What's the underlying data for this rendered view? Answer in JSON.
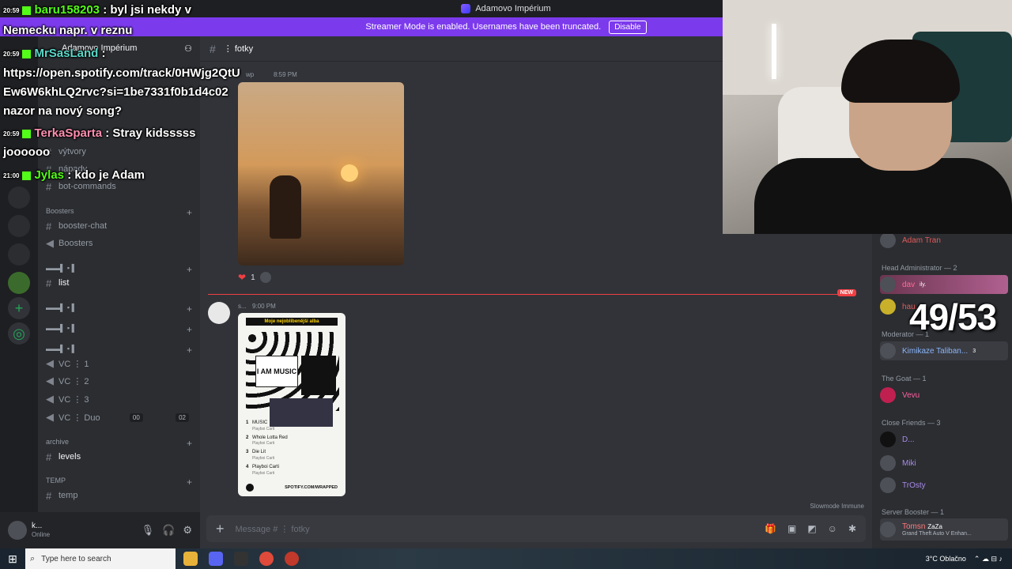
{
  "window": {
    "title": "Adamovo Impérium"
  },
  "streamer": {
    "text": "Streamer Mode is enabled. Usernames have been truncated.",
    "disable_label": "Disable"
  },
  "server": {
    "name": "Adamovo Impérium"
  },
  "sidebar": {
    "channels_top": [
      {
        "label": "výtvory"
      },
      {
        "label": "nápady"
      },
      {
        "label": "bot-commands"
      }
    ],
    "cat_boosters": "Boosters",
    "boosters": [
      {
        "label": "booster-chat"
      },
      {
        "label": "Boosters"
      }
    ],
    "list": "list",
    "vcs": [
      {
        "label": "VC ⋮ 1"
      },
      {
        "label": "VC ⋮ 2"
      },
      {
        "label": "VC ⋮ 3"
      },
      {
        "label": "VC ⋮ Duo"
      }
    ],
    "duo_a": "00",
    "duo_b": "02",
    "cat_archive": "archive",
    "levels": "levels",
    "cat_temp": "TEMP",
    "temp": "temp"
  },
  "user": {
    "name": "k...",
    "status": "Online"
  },
  "channel": {
    "name": "⋮ fotky"
  },
  "messages": {
    "m1_user": "wp",
    "m1_time": "8:59 PM",
    "reaction_count": "1",
    "new_label": "NEW",
    "m2_user": "s...",
    "m2_time": "9:00 PM",
    "card_title": "Moje nejoblíbenější alba",
    "card_music": "I AM MUSIC",
    "tracks": [
      {
        "n": "1",
        "title": "MUSIC",
        "artist": "Playboi Carti"
      },
      {
        "n": "2",
        "title": "Whole Lotta Red",
        "artist": "Playboi Carti"
      },
      {
        "n": "3",
        "title": "Die Lit",
        "artist": "Playboi Carti"
      },
      {
        "n": "4",
        "title": "Playboi Carti",
        "artist": "Playboi Carti"
      }
    ],
    "card_foot": "SPOTIFY.COM/WRAPPED"
  },
  "slowmode": "Slowmode Immune",
  "composer": {
    "placeholder": "Message # ⋮ fotky"
  },
  "members": {
    "top": "Adam Tran",
    "head_admin": "Head Administrator — 2",
    "dav": "dav",
    "dav_badge": "ily.",
    "hau": "hau...",
    "moderator": "Moderator — 1",
    "kimi": "Kimikaze Taliban...",
    "kimi_count": "3",
    "goat": "The Goat — 1",
    "vevu": "Vevu",
    "close": "Close Friends — 3",
    "d": "D...",
    "miki": "Miki",
    "trosty": "TrOsty",
    "booster": "Server Booster — 1",
    "tomsn": "Tomsn",
    "tomsn_tag": "ZaZa",
    "tomsn_activity": "Grand Theft Auto V Enhan..."
  },
  "counter": "49/53",
  "overlay": [
    {
      "time": "20:59",
      "user": "baru158203",
      "text": ": byl jsi nekdy v"
    },
    {
      "text": "Nemecku napr. v reznu"
    },
    {
      "time": "20:59",
      "user": "MrSasLand",
      "text": ":"
    },
    {
      "text": "https://open.spotify.com/track/0HWjg2QtU"
    },
    {
      "text": "Ew6W6khLQ2rvc?si=1be7331f0b1d4c02"
    },
    {
      "text": "nazor na nový song?"
    },
    {
      "time": "20:59",
      "user": "TerkaSparta",
      "text": ": Stray kidsssss"
    },
    {
      "text": "joooooo"
    },
    {
      "time": "21:00",
      "user": "Jylas",
      "text": ": kdo je Adam"
    }
  ],
  "taskbar": {
    "search": "Type here to search",
    "weather": "3°C  Oblačno"
  }
}
